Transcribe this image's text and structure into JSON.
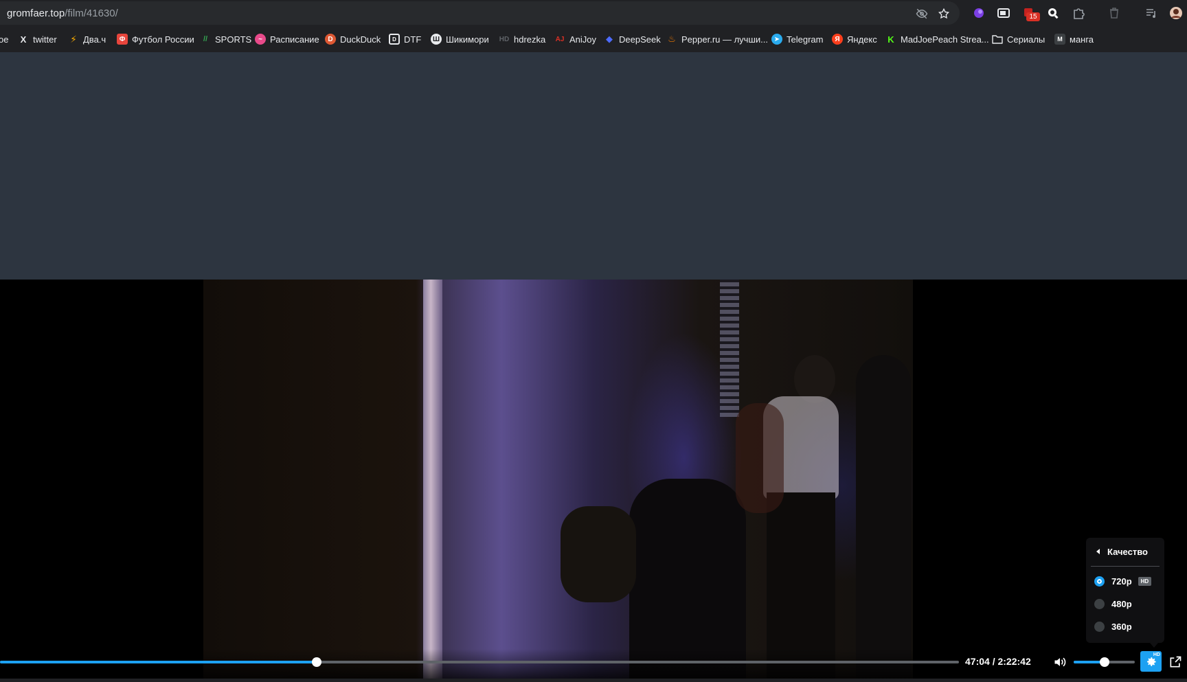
{
  "browser": {
    "url_host": "gromfaer.top",
    "url_path": "/film/41630/",
    "extension_badge": "15"
  },
  "bookmarks": [
    {
      "label": "ое",
      "icon": "cropped-bookmark-icon",
      "color": "#9aa0a6"
    },
    {
      "label": "twitter",
      "icon": "x-logo-icon",
      "color": "#000000"
    },
    {
      "label": "Два.ч",
      "icon": "lightning-icon",
      "color": "#f9ab00"
    },
    {
      "label": "Футбол России",
      "icon": "shield-icon",
      "color": "#e8453c"
    },
    {
      "label": "SPORTS",
      "icon": "sports-icon",
      "color": "#34a853"
    },
    {
      "label": "Расписание",
      "icon": "schedule-icon",
      "color": "#e84a8a"
    },
    {
      "label": "DuckDuck",
      "icon": "duckduckgo-icon",
      "color": "#de5833"
    },
    {
      "label": "DTF",
      "icon": "dtf-icon",
      "color": "#ffffff"
    },
    {
      "label": "Шикимори",
      "icon": "shikimori-icon",
      "color": "#ffffff"
    },
    {
      "label": "hdrezka",
      "icon": "hd-icon",
      "color": "#5f6368"
    },
    {
      "label": "AniJoy",
      "icon": "anijoy-icon",
      "color": "#d93025"
    },
    {
      "label": "DeepSeek",
      "icon": "whale-icon",
      "color": "#4d6bfe"
    },
    {
      "label": "Pepper.ru — лучши...",
      "icon": "flame-icon",
      "color": "#f57c00"
    },
    {
      "label": "Telegram",
      "icon": "telegram-icon",
      "color": "#2aabee"
    },
    {
      "label": "Яндекс",
      "icon": "yandex-icon",
      "color": "#fc3f1d"
    },
    {
      "label": "MadJoePeach Strea...",
      "icon": "kick-icon",
      "color": "#53fc18"
    },
    {
      "label": "Сериалы",
      "icon": "folder-icon",
      "color": "#e8eaed"
    },
    {
      "label": "манга",
      "icon": "manga-icon",
      "color": "#5f6368"
    }
  ],
  "player": {
    "current_time": "47:04",
    "separator": "/",
    "duration": "2:22:42",
    "progress_fraction": 0.33,
    "volume_fraction": 0.5,
    "accent_color": "#1da1f2",
    "settings_badge": "HD"
  },
  "quality_menu": {
    "title": "Качество",
    "options": [
      {
        "label": "720p",
        "selected": true,
        "tag": "HD"
      },
      {
        "label": "480p",
        "selected": false,
        "tag": ""
      },
      {
        "label": "360p",
        "selected": false,
        "tag": ""
      }
    ]
  }
}
